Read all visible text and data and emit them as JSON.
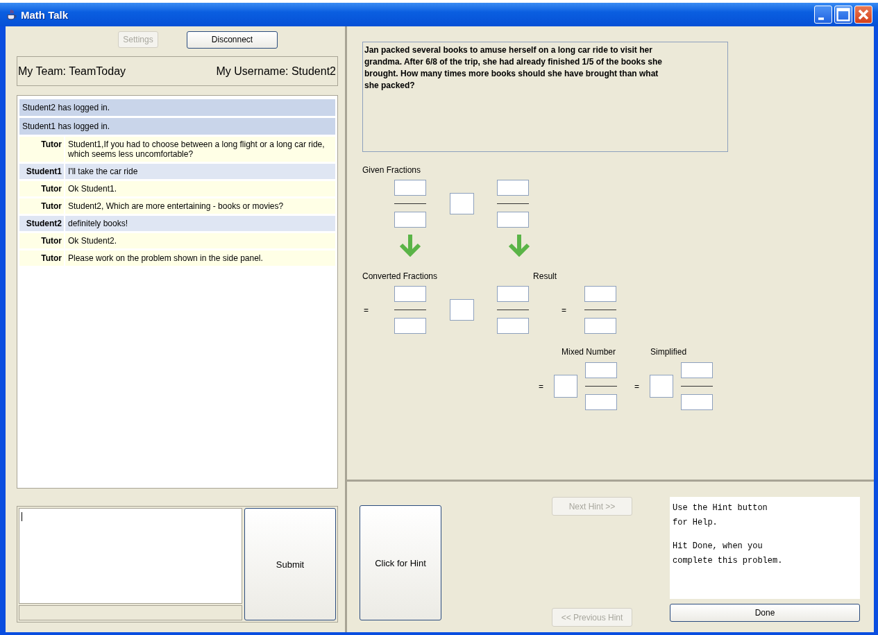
{
  "window": {
    "title": "Math Talk"
  },
  "left_panel": {
    "buttons": [
      {
        "label": "Settings",
        "disabled": true
      },
      {
        "label": "Disconnect",
        "disabled": false
      }
    ],
    "team": "My Team: TeamToday",
    "username": "My Username: Student2",
    "messages": [
      {
        "kind": "system",
        "text": "Student2 has logged in."
      },
      {
        "kind": "system",
        "text": "Student1 has logged in."
      },
      {
        "kind": "tutor",
        "sender": "Tutor",
        "text": "Student1,If you had to choose between a long flight or a long car ride, which seems less uncomfortable?"
      },
      {
        "kind": "student",
        "sender": "Student1",
        "text": "I'll take the car ride"
      },
      {
        "kind": "tutor",
        "sender": "Tutor",
        "text": "Ok Student1."
      },
      {
        "kind": "tutor",
        "sender": "Tutor",
        "text": "Student2, Which are more entertaining - books or movies?"
      },
      {
        "kind": "student",
        "sender": "Student2",
        "text": "definitely books!"
      },
      {
        "kind": "tutor",
        "sender": "Tutor",
        "text": "Ok Student2."
      },
      {
        "kind": "tutor",
        "sender": "Tutor",
        "text": "Please work on the problem shown in the side panel."
      }
    ],
    "submit": "Submit"
  },
  "problem": {
    "text": "Jan packed several books to amuse herself on a long car ride to visit her grandma.  After 6/8 of the trip, she had already finished 1/5 of the books she brought.  How many times more books should she have brought than what she packed?",
    "given_label": "Given Fractions",
    "converted_label": "Converted Fractions",
    "result_label": "Result",
    "mixed_label": "Mixed Number",
    "simplified_label": "Simplified",
    "equals": "="
  },
  "hint_panel": {
    "hint_button": "Click for Hint",
    "next": {
      "label": "Next Hint >>",
      "disabled": true
    },
    "previous": {
      "label": "<< Previous Hint",
      "disabled": true
    },
    "message": [
      "Use the Hint button\nfor Help.",
      "Hit Done, when you\ncomplete this problem."
    ],
    "done": "Done"
  }
}
